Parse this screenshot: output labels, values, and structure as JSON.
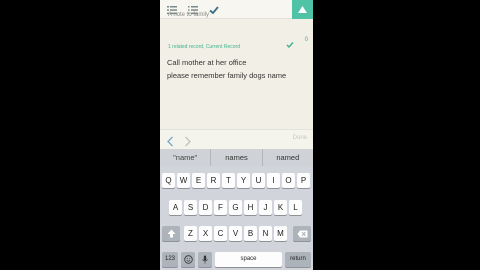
{
  "top": {
    "partial_line": "A note to family",
    "record_text": "1 related record, Current Record",
    "record_count": "0"
  },
  "note": {
    "line1": "Call mother at her office",
    "line2": "please remember family dogs name"
  },
  "accessory": {
    "done_label": "Done"
  },
  "suggestions": [
    "\"name\"",
    "names",
    "named"
  ],
  "keyboard": {
    "row1": [
      "Q",
      "W",
      "E",
      "R",
      "T",
      "Y",
      "U",
      "I",
      "O",
      "P"
    ],
    "row2": [
      "A",
      "S",
      "D",
      "F",
      "G",
      "H",
      "J",
      "K",
      "L"
    ],
    "row3": [
      "Z",
      "X",
      "C",
      "V",
      "B",
      "N",
      "M"
    ],
    "numbers_label": "123",
    "space_label": "space",
    "return_label": "return"
  },
  "colors": {
    "accent": "#4ec3a5",
    "link": "#3fb08e",
    "background": "#f2f0e6"
  },
  "icons": [
    "list-icon",
    "numbered-list-icon",
    "checkmark-icon",
    "arrow-up-icon",
    "chevron-left-icon",
    "chevron-right-icon",
    "shift-icon",
    "delete-icon",
    "emoji-icon",
    "microphone-icon"
  ]
}
